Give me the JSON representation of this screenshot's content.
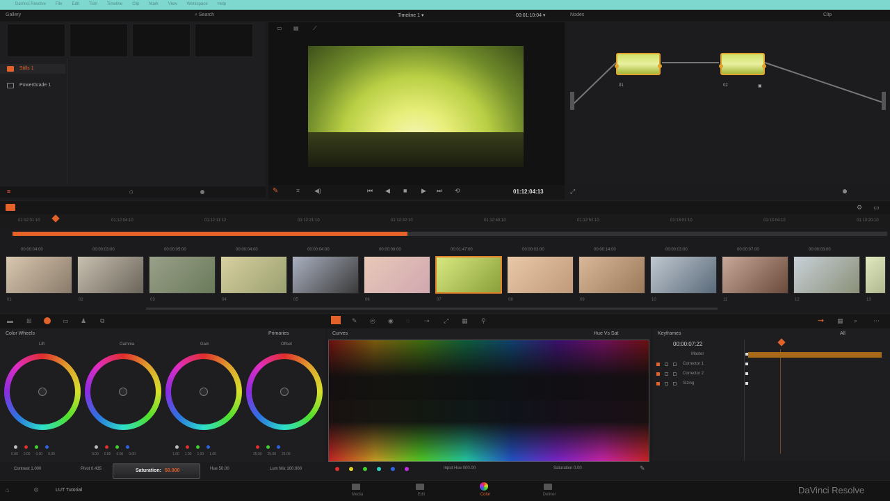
{
  "menubar": {
    "app": "DaVinci Resolve",
    "items": [
      "DaVinci Resolve",
      "File",
      "Edit",
      "Trim",
      "Timeline",
      "Clip",
      "Mark",
      "View",
      "Workspace",
      "Help"
    ]
  },
  "header": {
    "gallery_label": "Gallery",
    "search_placeholder": "Search",
    "timeline_name": "Timeline 1",
    "timecode_top": "00:01:10:04",
    "nodes_label": "Nodes",
    "clip_label": "Clip"
  },
  "gallery": {
    "items": [
      {
        "label": "Stills 1",
        "icon": "stills-icon"
      },
      {
        "label": "PowerGrade 1",
        "icon": "powergrade-icon"
      }
    ]
  },
  "viewer": {
    "playhead_timecode": "01:12:04:13"
  },
  "timeline": {
    "ruler_marks": [
      "01:12:01:10",
      "01:12:04:10",
      "01:12:11:12",
      "01:12:21:10",
      "01:12:32:10",
      "01:12:40:10",
      "01:12:52:10",
      "01:13:01:10",
      "01:13:04:10",
      "01:13:20:10"
    ],
    "clips": [
      {
        "tc": "00:00:04:00",
        "label": "01",
        "selected": false,
        "colors": [
          "#d8c8b0",
          "#8a7a6a"
        ]
      },
      {
        "tc": "00:00:03:00",
        "label": "02",
        "selected": false,
        "colors": [
          "#c8c0b0",
          "#6a645a"
        ]
      },
      {
        "tc": "00:00:05:00",
        "label": "03",
        "selected": false,
        "colors": [
          "#9aa08a",
          "#6a7a5a"
        ]
      },
      {
        "tc": "00:00:04:00",
        "label": "04",
        "selected": false,
        "colors": [
          "#d8d0a0",
          "#9aa070"
        ]
      },
      {
        "tc": "00:00:04:00",
        "label": "05",
        "selected": false,
        "colors": [
          "#aab0c0",
          "#3a3a3a"
        ]
      },
      {
        "tc": "00:00:08:00",
        "label": "06",
        "selected": false,
        "colors": [
          "#e8c8b8",
          "#d0a8b0"
        ]
      },
      {
        "tc": "00:01:47:00",
        "label": "07",
        "selected": true,
        "colors": [
          "#d8e880",
          "#8aa03a"
        ]
      },
      {
        "tc": "00:00:03:00",
        "label": "08",
        "selected": false,
        "colors": [
          "#e8c8a8",
          "#c09a7a"
        ]
      },
      {
        "tc": "00:00:14:00",
        "label": "09",
        "selected": false,
        "colors": [
          "#d8b898",
          "#9a7a5a"
        ]
      },
      {
        "tc": "00:00:03:00",
        "label": "10",
        "selected": false,
        "colors": [
          "#c0c8d0",
          "#5a6a7a"
        ]
      },
      {
        "tc": "00:00:07:00",
        "label": "11",
        "selected": false,
        "colors": [
          "#c8a898",
          "#6a4a3a"
        ]
      },
      {
        "tc": "00:00:03:00",
        "label": "12",
        "selected": false,
        "colors": [
          "#c8d0d8",
          "#8a9078"
        ]
      },
      {
        "tc": "",
        "label": "13",
        "selected": false,
        "colors": [
          "#e0e8c0",
          "#b0b890"
        ]
      }
    ]
  },
  "color_wheels": {
    "panel_title": "Color Wheels",
    "mode": "Primaries",
    "wheels": [
      {
        "name": "Lift",
        "values": [
          "0.00",
          "0.00",
          "0.00",
          "0.00"
        ]
      },
      {
        "name": "Gamma",
        "values": [
          "0.00",
          "0.00",
          "0.00",
          "0.00"
        ]
      },
      {
        "name": "Gain",
        "values": [
          "1.00",
          "1.00",
          "1.00",
          "1.00"
        ]
      },
      {
        "name": "Offset",
        "values": [
          "25.00",
          "25.00",
          "25.00"
        ]
      }
    ],
    "contrast": "Contrast 1.000",
    "pivot": "Pivot 0.435",
    "saturation_tooltip_label": "Saturation:",
    "saturation_tooltip_value": "50.000",
    "hue": "Hue 50.00",
    "lum_mix": "Lum Mix 100.000"
  },
  "curves": {
    "panel_title": "Curves",
    "mode": "Hue Vs Sat",
    "input_hue": "Input Hue 000.00",
    "saturation": "Saturation 0.00"
  },
  "keyframes": {
    "panel_title": "Keyframes",
    "all_label": "All",
    "timecode": "00:00:07:22",
    "tracks": [
      "Master",
      "Corrector 1",
      "Corrector 2",
      "Sizing"
    ]
  },
  "footer": {
    "project_name": "LUT Tutorial",
    "pages": [
      "Media",
      "Edit",
      "Color",
      "Deliver"
    ],
    "active_page": "Color",
    "brand": "DaVinci Resolve"
  },
  "colors": {
    "accent": "#e2622a",
    "selected_clip": "#e2822a",
    "menubar": "#7fd8cf"
  }
}
